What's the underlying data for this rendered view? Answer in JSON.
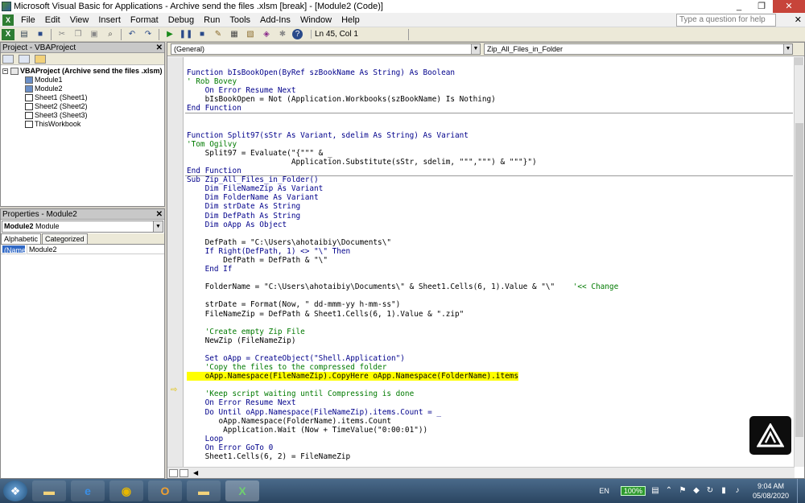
{
  "window": {
    "title": "Microsoft Visual Basic for Applications - Archive send the files .xlsm [break] - [Module2 (Code)]",
    "minimize": "_",
    "restore": "❐",
    "close": "✕"
  },
  "menu": {
    "items": [
      "File",
      "Edit",
      "View",
      "Insert",
      "Format",
      "Debug",
      "Run",
      "Tools",
      "Add-Ins",
      "Window",
      "Help"
    ],
    "help_placeholder": "Type a question for help",
    "close": "✕"
  },
  "toolbar": {
    "position_text": "Ln 45, Col 1"
  },
  "project_pane": {
    "title": "Project - VBAProject",
    "close": "✕",
    "root": "VBAProject (Archive send the files .xlsm)",
    "items": [
      "Module1",
      "Module2",
      "Sheet1 (Sheet1)",
      "Sheet2 (Sheet2)",
      "Sheet3 (Sheet3)",
      "ThisWorkbook"
    ]
  },
  "properties_pane": {
    "title": "Properties - Module2",
    "close": "✕",
    "object_bold": "Module2",
    "object_type": "Module",
    "tab_alpha": "Alphabetic",
    "tab_cat": "Categorized",
    "prop_name": "(Name)",
    "prop_value": "Module2"
  },
  "code_window": {
    "object_combo": "(General)",
    "proc_combo": "Zip_All_Files_in_Folder",
    "current_line_index": 35
  },
  "code_lines": [
    {
      "t": "Function bIsBookOpen(ByRef szBookName As String) As Boolean",
      "c": "kw"
    },
    {
      "t": "' Rob Bovey",
      "c": "cm"
    },
    {
      "t": "    On Error Resume Next",
      "c": "kw"
    },
    {
      "t": "    bIsBookOpen = Not (Application.Workbooks(szBookName) Is Nothing)",
      "c": ""
    },
    {
      "t": "End Function",
      "c": "kw",
      "sep": true
    },
    {
      "t": "",
      "c": ""
    },
    {
      "t": "",
      "c": ""
    },
    {
      "t": "Function Split97(sStr As Variant, sdelim As String) As Variant",
      "c": "kw"
    },
    {
      "t": "'Tom Ogilvy",
      "c": "cm"
    },
    {
      "t": "    Split97 = Evaluate(\"{\"\"\" & _",
      "c": ""
    },
    {
      "t": "                       Application.Substitute(sStr, sdelim, \"\"\",\"\"\") & \"\"\"}\")",
      "c": ""
    },
    {
      "t": "End Function",
      "c": "kw",
      "sep": true
    },
    {
      "t": "Sub Zip_All_Files_in_Folder()",
      "c": "kw"
    },
    {
      "t": "    Dim FileNameZip As Variant",
      "c": "kw"
    },
    {
      "t": "    Dim FolderName As Variant",
      "c": "kw"
    },
    {
      "t": "    Dim strDate As String",
      "c": "kw"
    },
    {
      "t": "    Dim DefPath As String",
      "c": "kw"
    },
    {
      "t": "    Dim oApp As Object",
      "c": "kw"
    },
    {
      "t": "",
      "c": ""
    },
    {
      "t": "    DefPath = \"C:\\Users\\ahotaibiy\\Documents\\\"",
      "c": ""
    },
    {
      "t": "    If Right(DefPath, 1) <> \"\\\" Then",
      "c": "kw"
    },
    {
      "t": "        DefPath = DefPath & \"\\\"",
      "c": ""
    },
    {
      "t": "    End If",
      "c": "kw"
    },
    {
      "t": "",
      "c": ""
    },
    {
      "t": "    FolderName = \"C:\\Users\\ahotaibiy\\Documents\\\" & Sheet1.Cells(6, 1).Value & \"\\\"    '<< Change",
      "c": "mixcm"
    },
    {
      "t": "",
      "c": ""
    },
    {
      "t": "    strDate = Format(Now, \" dd-mmm-yy h-mm-ss\")",
      "c": ""
    },
    {
      "t": "    FileNameZip = DefPath & Sheet1.Cells(6, 1).Value & \".zip\"",
      "c": ""
    },
    {
      "t": "",
      "c": ""
    },
    {
      "t": "    'Create empty Zip File",
      "c": "cm"
    },
    {
      "t": "    NewZip (FileNameZip)",
      "c": ""
    },
    {
      "t": "",
      "c": ""
    },
    {
      "t": "    Set oApp = CreateObject(\"Shell.Application\")",
      "c": "kw"
    },
    {
      "t": "    'Copy the files to the compressed folder",
      "c": "cm"
    },
    {
      "t": "    oApp.Namespace(FileNameZip).CopyHere oApp.Namespace(FolderName).items",
      "c": "hl"
    },
    {
      "t": "",
      "c": ""
    },
    {
      "t": "    'Keep script waiting until Compressing is done",
      "c": "cm"
    },
    {
      "t": "    On Error Resume Next",
      "c": "kw"
    },
    {
      "t": "    Do Until oApp.Namespace(FileNameZip).items.Count = _",
      "c": "kw"
    },
    {
      "t": "       oApp.Namespace(FolderName).items.Count",
      "c": ""
    },
    {
      "t": "        Application.Wait (Now + TimeValue(\"0:00:01\"))",
      "c": ""
    },
    {
      "t": "    Loop",
      "c": "kw"
    },
    {
      "t": "    On Error GoTo 0",
      "c": "kw"
    },
    {
      "t": "    Sheet1.Cells(6, 2) = FileNameZip",
      "c": ""
    }
  ],
  "taskbar": {
    "lang": "EN",
    "battery": "100%",
    "time": "9:04 AM",
    "date": "05/08/2020"
  },
  "colors": {
    "keyword": "#00008b",
    "comment": "#007a00",
    "highlight": "#ffff00"
  }
}
